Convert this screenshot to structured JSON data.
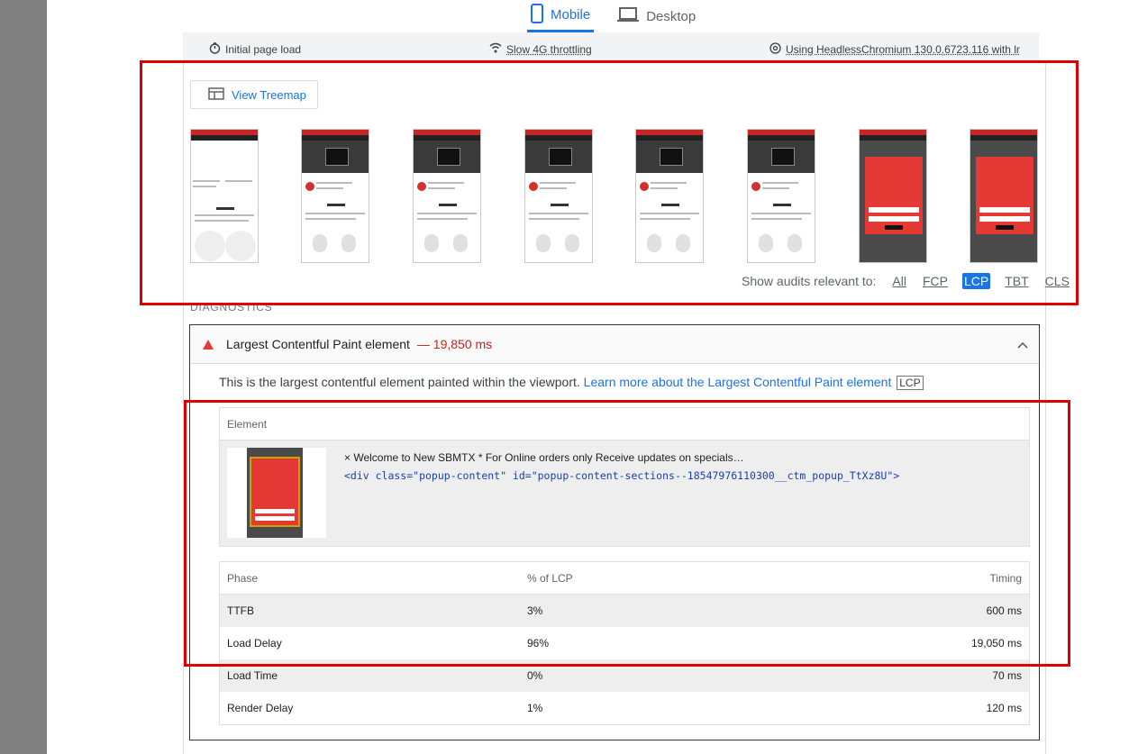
{
  "tabs": [
    {
      "label": "Mobile",
      "icon": "phone-icon",
      "active": true
    },
    {
      "label": "Desktop",
      "icon": "laptop-icon",
      "active": false
    }
  ],
  "env": {
    "page_load": "Initial page load",
    "throttling": "Slow 4G throttling",
    "browser": "Using HeadlessChromium 130.0.6723.116 with lr"
  },
  "treemap": {
    "label": "View Treemap"
  },
  "relevant": {
    "label": "Show audits relevant to:",
    "options": [
      "All",
      "FCP",
      "LCP",
      "TBT",
      "CLS"
    ],
    "active": "LCP"
  },
  "diagnostics_heading": "DIAGNOSTICS",
  "audit": {
    "title": "Largest Contentful Paint element",
    "value": "— 19,850 ms",
    "description": "This is the largest contentful element painted within the viewport.",
    "link": "Learn more about the Largest Contentful Paint element",
    "tag": "LCP"
  },
  "element": {
    "header": "Element",
    "text": "× Welcome to New SBMTX * For Online orders only Receive updates on specials…",
    "code": "<div class=\"popup-content\" id=\"popup-content-sections--18547976110300__ctm_popup_TtXz8U\">"
  },
  "phases": {
    "headers": [
      "Phase",
      "% of LCP",
      "Timing"
    ],
    "rows": [
      [
        "TTFB",
        "3%",
        "600 ms"
      ],
      [
        "Load Delay",
        "96%",
        "19,050 ms"
      ],
      [
        "Load Time",
        "0%",
        "70 ms"
      ],
      [
        "Render Delay",
        "1%",
        "120 ms"
      ]
    ]
  },
  "colors": {
    "accent": "#1a73e8",
    "fail": "#e53935",
    "highlight": "#e10000"
  }
}
